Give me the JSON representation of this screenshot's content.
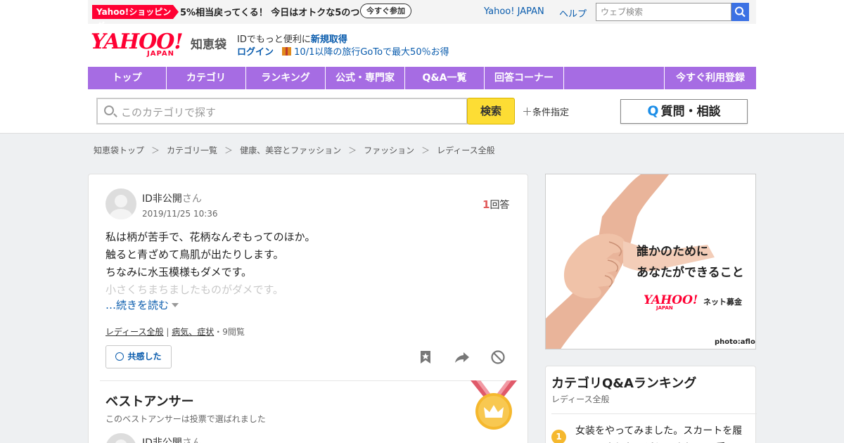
{
  "topbar": {
    "shop_tag": "Yahoo!ショッピング",
    "promo": "5%相当戻ってくる！ 今日はオトクな5のつく日",
    "promo_button": "今すぐ参加",
    "links": [
      "Yahoo! JAPAN",
      "ヘルプ"
    ],
    "web_search_placeholder": "ウェブ検索"
  },
  "header": {
    "logo": "YAHOO!",
    "logo_sub": "JAPAN",
    "service": "知恵袋",
    "id_text": "IDでもっと便利に",
    "id_link": "新規取得",
    "login": "ログイン",
    "campaign": "10/1以降の旅行GoToで最大50％お得"
  },
  "nav": {
    "items": [
      "トップ",
      "カテゴリ",
      "ランキング",
      "公式・専門家",
      "Q&A一覧",
      "回答コーナー"
    ],
    "register": "今すぐ利用登録"
  },
  "search": {
    "placeholder": "このカテゴリで探す",
    "button": "検索",
    "conditions": "条件指定",
    "ask_q": "Q",
    "ask_label": "質問・相談"
  },
  "breadcrumb": [
    "知恵袋トップ",
    "カテゴリ一覧",
    "健康、美容とファッション",
    "ファッション",
    "レディース全般"
  ],
  "breadcrumb_sep": "＞",
  "question": {
    "user": "ID非公開",
    "honorific": "さん",
    "date": "2019/11/25 10:36",
    "answer_count": "1",
    "answer_label": "回答",
    "lines": [
      "私は柄が苦手で、花柄なんぞもってのほか。",
      "触ると青ざめて鳥肌が出たりします。",
      "ちなみに水玉模様もダメです。",
      "小さくちまちましたものがダメです。"
    ],
    "more": "…続きを読む",
    "tags": [
      "レディース全般",
      "病気、症状"
    ],
    "tag_sep": " | ",
    "views": "・9閲覧",
    "empathy": "共感した"
  },
  "best_answer": {
    "title": "ベストアンサー",
    "note": "このベストアンサーは投票で選ばれました",
    "user": "ID非公開",
    "honorific": "さん"
  },
  "ad": {
    "line1": "誰かのために",
    "line2": "あなたができること",
    "brand": "YAHOO!",
    "brand_sub": "JAPAN",
    "service": "ネット募金",
    "credit": "photo:aflo"
  },
  "ranking": {
    "title": "カテゴリQ&Aランキング",
    "subtitle": "レディース全般",
    "items": [
      {
        "rank": "1",
        "text": "女装をやってみました。スカートを履いてみました。どうですか？ 可愛い"
      }
    ]
  },
  "colors": {
    "brand_red": "#ff0033",
    "nav_purple": "#a66ce3",
    "search_yellow": "#fddd34",
    "link_blue": "#0a5cad",
    "medal_gold": "#f5b82e"
  },
  "icons": [
    "search-icon",
    "plus-icon",
    "gift-icon",
    "smile-icon",
    "bookmark-icon",
    "share-icon",
    "block-icon",
    "medal-icon",
    "crown-icon",
    "caret-down-icon"
  ]
}
